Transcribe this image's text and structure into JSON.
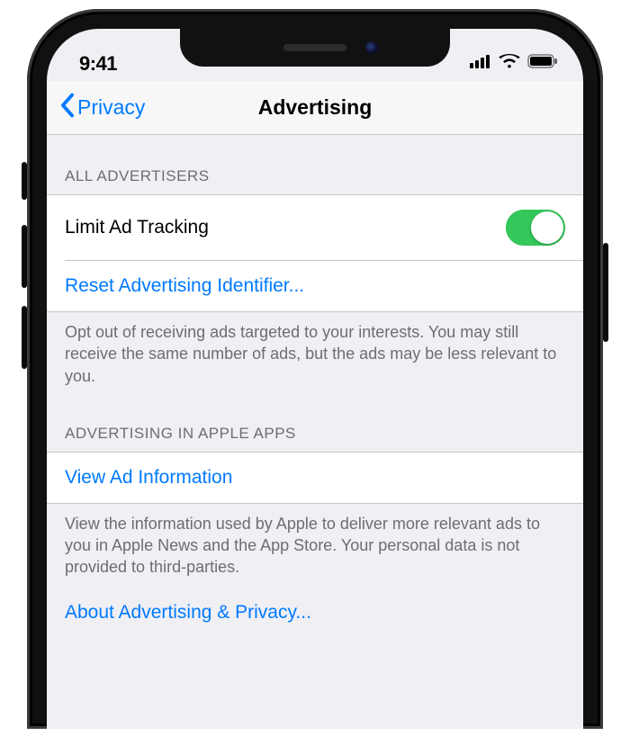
{
  "statusbar": {
    "time": "9:41"
  },
  "navbar": {
    "back_label": "Privacy",
    "title": "Advertising"
  },
  "section1": {
    "header": "ALL ADVERTISERS",
    "limit_label": "Limit Ad Tracking",
    "limit_on": true,
    "reset_label": "Reset Advertising Identifier...",
    "footer": "Opt out of receiving ads targeted to your interests. You may still receive the same number of ads, but the ads may be less relevant to you."
  },
  "section2": {
    "header": "ADVERTISING IN APPLE APPS",
    "view_label": "View Ad Information",
    "footer": "View the information used by Apple to deliver more relevant ads to you in Apple News and the App Store. Your personal data is not provided to third-parties.",
    "about_link": "About Advertising & Privacy..."
  }
}
